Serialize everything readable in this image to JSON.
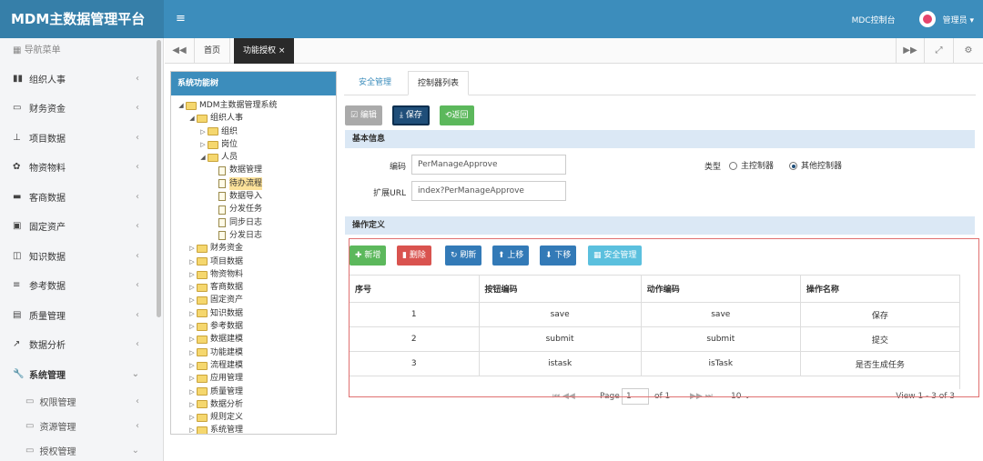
{
  "header": {
    "logo": "MDM主数据管理平台",
    "menu_icon": "≡",
    "mdc": "MDC控制台",
    "user": "管理员 ▾"
  },
  "sidebar": {
    "title": "导航菜单",
    "items": [
      {
        "icon": "▮▮",
        "label": "组织人事",
        "chev": "‹"
      },
      {
        "icon": "▭",
        "label": "财务资金",
        "chev": "‹"
      },
      {
        "icon": "⊥",
        "label": "项目数据",
        "chev": "‹"
      },
      {
        "icon": "✿",
        "label": "物资物料",
        "chev": "‹"
      },
      {
        "icon": "▬",
        "label": "客商数据",
        "chev": "‹"
      },
      {
        "icon": "▣",
        "label": "固定资产",
        "chev": "‹"
      },
      {
        "icon": "◫",
        "label": "知识数据",
        "chev": "‹"
      },
      {
        "icon": "≡",
        "label": "参考数据",
        "chev": "‹"
      },
      {
        "icon": "▤",
        "label": "质量管理",
        "chev": "‹"
      },
      {
        "icon": "↗",
        "label": "数据分析",
        "chev": "‹"
      },
      {
        "icon": "🔧",
        "label": "系统管理",
        "chev": "⌄"
      }
    ],
    "subitems": [
      {
        "icon": "▭",
        "label": "权限管理",
        "chev": "‹"
      },
      {
        "icon": "▭",
        "label": "资源管理",
        "chev": "‹"
      },
      {
        "icon": "▭",
        "label": "授权管理",
        "chev": "⌄"
      }
    ]
  },
  "tabbar": {
    "back": "◀◀",
    "home": "首页",
    "active": "功能授权 ×",
    "fwd": "▶▶",
    "full": "⤢",
    "gear": "⚙"
  },
  "tree": {
    "title": "系统功能树",
    "rows": [
      {
        "indent": 0,
        "tg": "◢",
        "type": "folder",
        "label": "MDM主数据管理系统"
      },
      {
        "indent": 1,
        "tg": "◢",
        "type": "folder",
        "label": "组织人事"
      },
      {
        "indent": 2,
        "tg": "▷",
        "type": "folder",
        "label": "组织"
      },
      {
        "indent": 2,
        "tg": "▷",
        "type": "folder",
        "label": "岗位"
      },
      {
        "indent": 2,
        "tg": "◢",
        "type": "folder",
        "label": "人员"
      },
      {
        "indent": 3,
        "tg": "",
        "type": "file",
        "label": "数据管理"
      },
      {
        "indent": 3,
        "tg": "",
        "type": "file",
        "label": "待办流程",
        "sel": true
      },
      {
        "indent": 3,
        "tg": "",
        "type": "file",
        "label": "数据导入"
      },
      {
        "indent": 3,
        "tg": "",
        "type": "file",
        "label": "分发任务"
      },
      {
        "indent": 3,
        "tg": "",
        "type": "file",
        "label": "同步日志"
      },
      {
        "indent": 3,
        "tg": "",
        "type": "file",
        "label": "分发日志"
      },
      {
        "indent": 1,
        "tg": "▷",
        "type": "folder",
        "label": "财务资金"
      },
      {
        "indent": 1,
        "tg": "▷",
        "type": "folder",
        "label": "项目数据"
      },
      {
        "indent": 1,
        "tg": "▷",
        "type": "folder",
        "label": "物资物料"
      },
      {
        "indent": 1,
        "tg": "▷",
        "type": "folder",
        "label": "客商数据"
      },
      {
        "indent": 1,
        "tg": "▷",
        "type": "folder",
        "label": "固定资产"
      },
      {
        "indent": 1,
        "tg": "▷",
        "type": "folder",
        "label": "知识数据"
      },
      {
        "indent": 1,
        "tg": "▷",
        "type": "folder",
        "label": "参考数据"
      },
      {
        "indent": 1,
        "tg": "▷",
        "type": "folder",
        "label": "数据建模"
      },
      {
        "indent": 1,
        "tg": "▷",
        "type": "folder",
        "label": "功能建模"
      },
      {
        "indent": 1,
        "tg": "▷",
        "type": "folder",
        "label": "流程建模"
      },
      {
        "indent": 1,
        "tg": "▷",
        "type": "folder",
        "label": "应用管理"
      },
      {
        "indent": 1,
        "tg": "▷",
        "type": "folder",
        "label": "质量管理"
      },
      {
        "indent": 1,
        "tg": "▷",
        "type": "folder",
        "label": "数据分析"
      },
      {
        "indent": 1,
        "tg": "▷",
        "type": "folder",
        "label": "规则定义"
      },
      {
        "indent": 1,
        "tg": "▷",
        "type": "folder",
        "label": "系统管理"
      }
    ]
  },
  "content": {
    "tabs": [
      "安全管理",
      "控制器列表"
    ],
    "buttons": {
      "edit": "☑ 编辑",
      "save": "⤓ 保存",
      "back": "⟲返回"
    },
    "basic": {
      "title": "基本信息",
      "code_label": "编码",
      "code_value": "PerManageApprove",
      "url_label": "扩展URL",
      "url_value": "index?PerManageApprove",
      "type_label": "类型",
      "opt1": "主控制器",
      "opt2": "其他控制器"
    },
    "ops": {
      "title": "操作定义",
      "add": "✚ 新增",
      "del": "▮ 删除",
      "refresh": "↻ 刷新",
      "up": "⬆ 上移",
      "down": "⬇ 下移",
      "security": "▦ 安全管理"
    },
    "table": {
      "headers": [
        "序号",
        "按钮编码",
        "动作编码",
        "操作名称"
      ],
      "rows": [
        [
          "1",
          "save",
          "save",
          "保存"
        ],
        [
          "2",
          "submit",
          "submit",
          "提交"
        ],
        [
          "3",
          "istask",
          "isTask",
          "是否生成任务"
        ]
      ]
    },
    "pager": {
      "nav_left": "⏮ ◀◀",
      "page": "Page",
      "page_num": "1",
      "of": "of 1",
      "nav_right": "▶▶ ⏭",
      "size": "10 ⌄",
      "view": "View 1 - 3 of 3"
    }
  }
}
